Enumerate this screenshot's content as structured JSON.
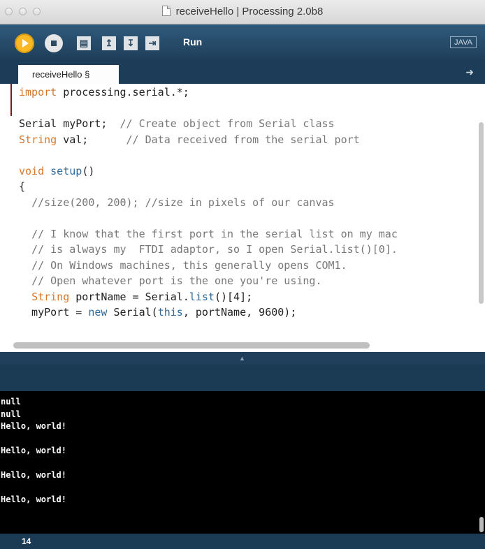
{
  "window": {
    "title": "receiveHello | Processing 2.0b8"
  },
  "toolbar": {
    "run_label": "Run",
    "mode": "JAVA",
    "buttons": [
      "play-icon",
      "stop-icon",
      "new-file-icon",
      "open-file-icon",
      "save-file-icon",
      "export-icon"
    ]
  },
  "tabs": [
    {
      "label": "receiveHello §"
    }
  ],
  "editor": {
    "lines": [
      "import processing.serial.*;",
      "",
      "Serial myPort;  // Create object from Serial class",
      "String val;      // Data received from the serial port",
      "",
      "void setup()",
      "{",
      "  //size(200, 200); //size in pixels of our canvas",
      "",
      "  // I know that the first port in the serial list on my mac",
      "  // is always my  FTDI adaptor, so I open Serial.list()[0].",
      "  // On Windows machines, this generally opens COM1.",
      "  // Open whatever port is the one you're using.",
      "  String portName = Serial.list()[4];",
      "  myPort = new Serial(this, portName, 9600);"
    ]
  },
  "console": {
    "lines": [
      "null",
      "null",
      "Hello, world!",
      "",
      "Hello, world!",
      "",
      "Hello, world!",
      "",
      "Hello, world!"
    ]
  },
  "status": {
    "line_number": "14"
  },
  "colors": {
    "toolbar": "#2f5a7c",
    "run_button": "#f9b824",
    "keyword": "#d9772b",
    "function": "#2f6a9a",
    "comment": "#777777"
  }
}
